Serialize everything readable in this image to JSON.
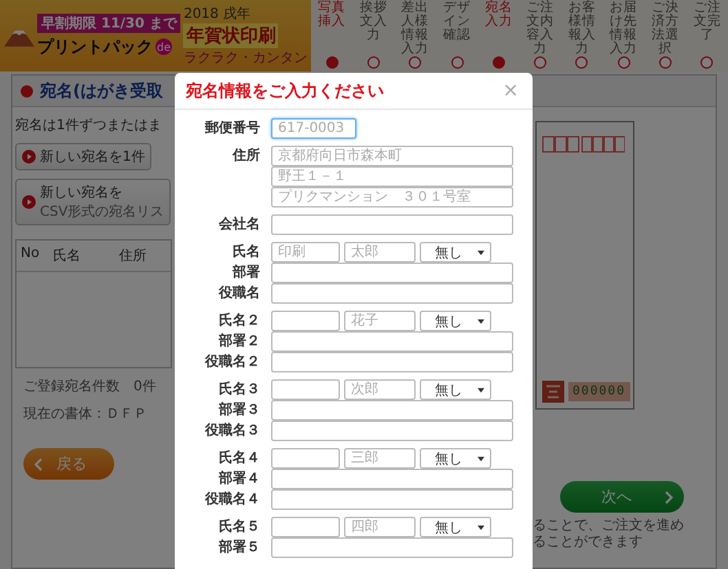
{
  "header": {
    "banner": {
      "deadline": "早割期限 11/30 まで",
      "brand": "プリントパック",
      "brand_badge": "de",
      "product": "年賀状印刷",
      "year": "2018 戌年",
      "tagline": "ラクラク・カンタン"
    },
    "steps": [
      {
        "label": "写真挿入",
        "selected": true
      },
      {
        "label": "挨拶文入力",
        "selected": false
      },
      {
        "label": "差出人様情報入力",
        "selected": false
      },
      {
        "label": "デザイン確認",
        "selected": false
      },
      {
        "label": "宛名入力",
        "selected": true
      },
      {
        "label": "ご注文内容入力",
        "selected": false
      },
      {
        "label": "お客様情報入力",
        "selected": false
      },
      {
        "label": "お届け先情報入力",
        "selected": false
      },
      {
        "label": "ご決済方法選択",
        "selected": false
      },
      {
        "label": "ご注文完了",
        "selected": false
      }
    ]
  },
  "page": {
    "heading": "宛名(はがき受取",
    "intro": "宛名は1件ずつまたはま",
    "add_buttons": [
      {
        "label": "新しい宛名を1件"
      },
      {
        "label": "新しい宛名を",
        "sub": "CSV形式の宛名リス"
      }
    ],
    "table": {
      "columns": [
        "No",
        "氏名",
        "住所"
      ]
    },
    "count": "ご登録宛名件数　0件",
    "font": "現在の書体：ＤＦＰ",
    "back": "戻る",
    "postcard": {
      "number": "000000"
    },
    "next": "次へ",
    "note": "ることで、ご注文を進めることができます"
  },
  "modal": {
    "title": "宛名情報をご入力ください",
    "close": "×",
    "sections": [
      [
        {
          "kind": "single",
          "label": "郵便番号",
          "placeholder": "617-0003",
          "focused": true
        }
      ],
      [
        {
          "kind": "multi",
          "label": "住所",
          "lines": [
            {
              "placeholder": "京都府向日市森本町"
            },
            {
              "placeholder": "野王１－１"
            },
            {
              "placeholder": "プリクマンション　３０１号室"
            }
          ]
        }
      ],
      [
        {
          "kind": "single",
          "label": "会社名",
          "focused": false
        }
      ],
      [
        {
          "kind": "name",
          "label": "氏名",
          "first": {
            "placeholder": "印刷"
          },
          "second": {
            "placeholder": "太郎"
          },
          "honorific": "無し"
        },
        {
          "kind": "single",
          "label": "部署",
          "focused": false
        },
        {
          "kind": "single",
          "label": "役職名",
          "focused": false
        }
      ],
      [
        {
          "kind": "name",
          "label": "氏名２",
          "second": {
            "placeholder": "花子"
          },
          "honorific": "無し"
        },
        {
          "kind": "single",
          "label": "部署２",
          "focused": false
        },
        {
          "kind": "single",
          "label": "役職名２",
          "focused": false
        }
      ],
      [
        {
          "kind": "name",
          "label": "氏名３",
          "second": {
            "placeholder": "次郎"
          },
          "honorific": "無し"
        },
        {
          "kind": "single",
          "label": "部署３",
          "focused": false
        },
        {
          "kind": "single",
          "label": "役職名３",
          "focused": false
        }
      ],
      [
        {
          "kind": "name",
          "label": "氏名４",
          "second": {
            "placeholder": "三郎"
          },
          "honorific": "無し"
        },
        {
          "kind": "single",
          "label": "部署４",
          "focused": false
        },
        {
          "kind": "single",
          "label": "役職名４",
          "focused": false
        }
      ],
      [
        {
          "kind": "name",
          "label": "氏名５",
          "second": {
            "placeholder": "四郎"
          },
          "honorific": "無し"
        },
        {
          "kind": "single",
          "label": "部署５",
          "focused": false
        }
      ]
    ]
  }
}
